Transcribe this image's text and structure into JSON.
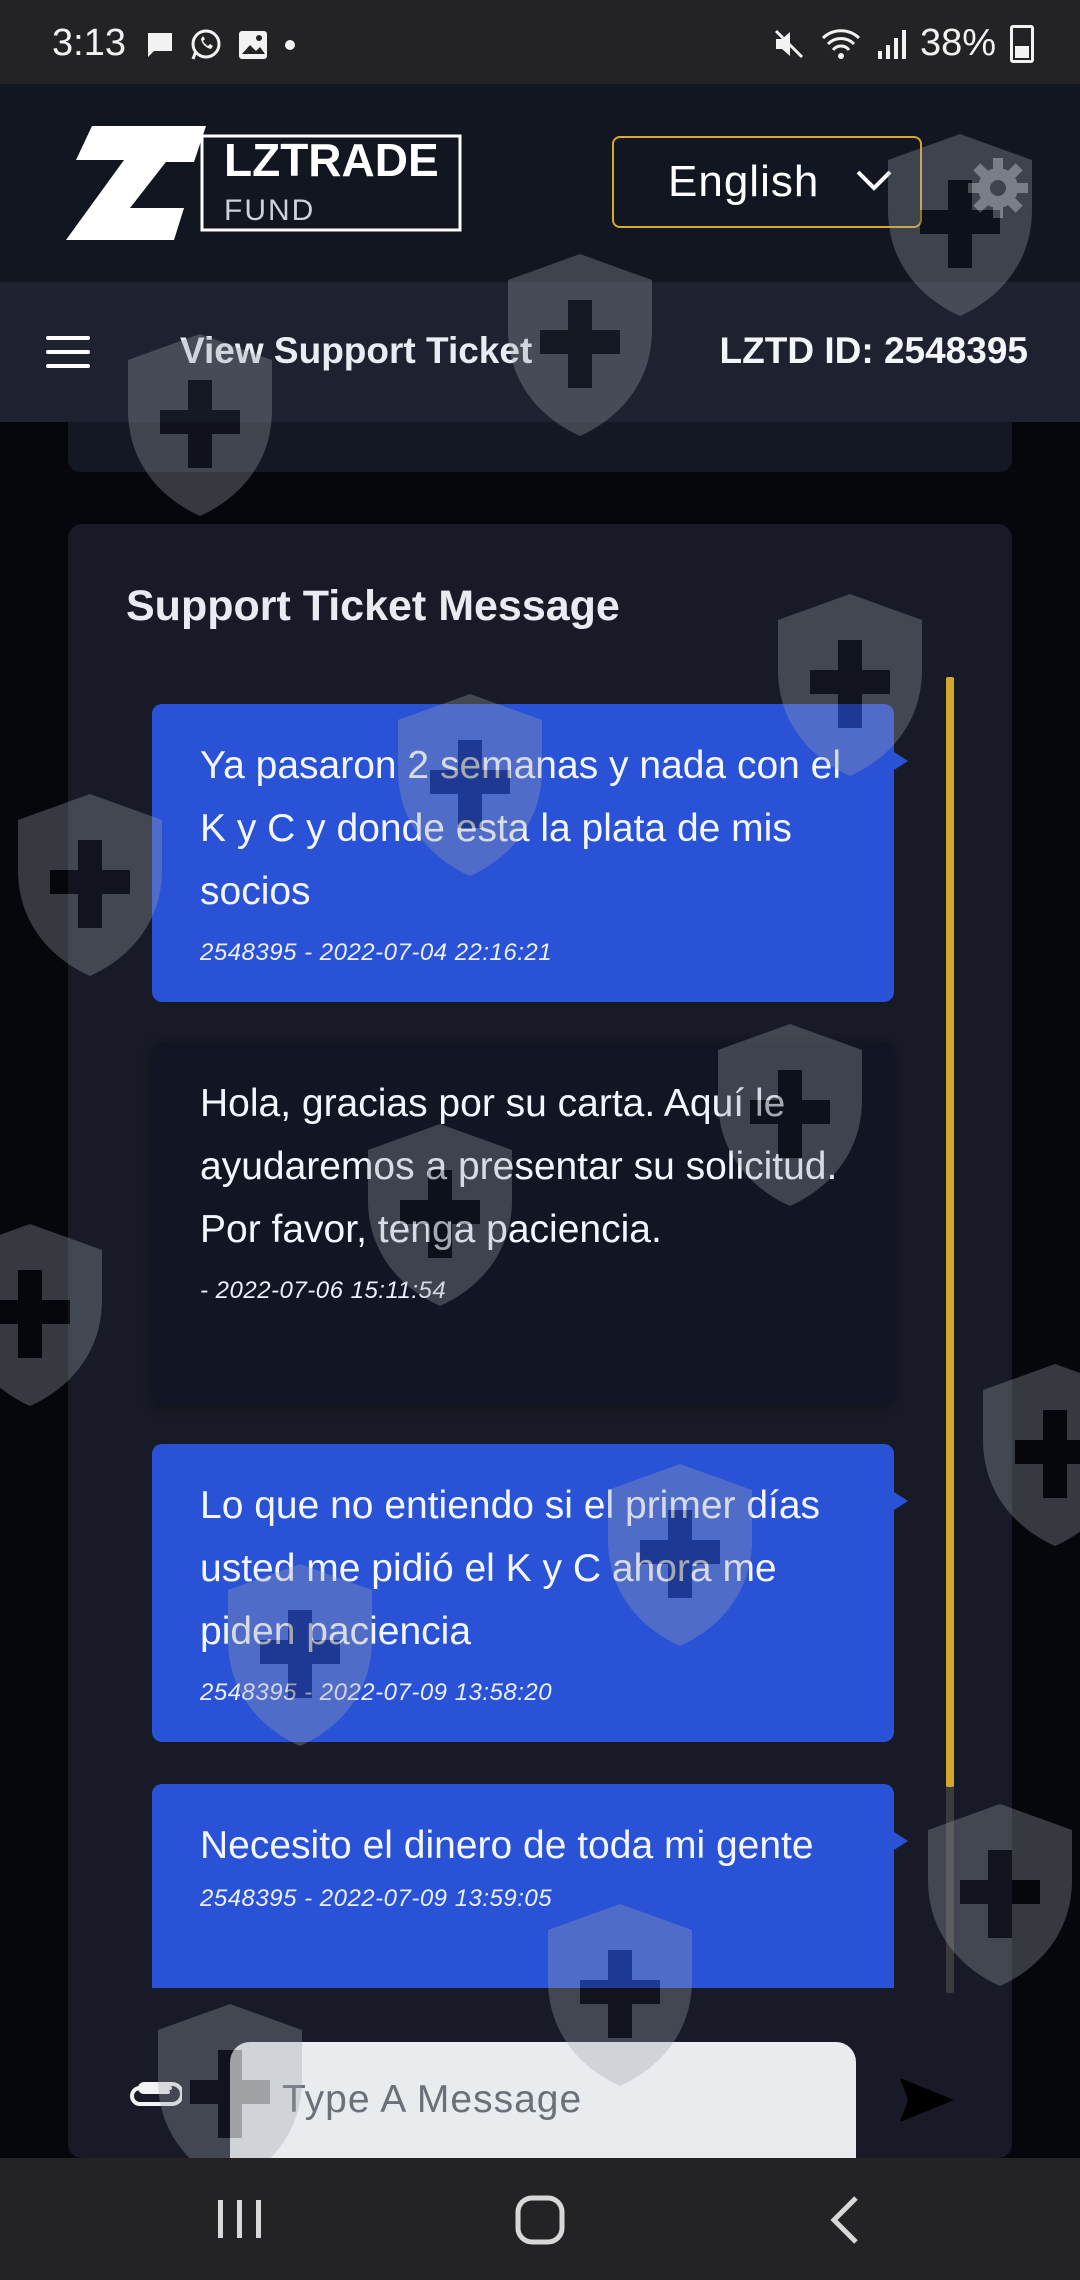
{
  "status_bar": {
    "time": "3:13",
    "battery": "38%",
    "icons": [
      "message-icon",
      "whatsapp-icon",
      "gallery-icon",
      "dot-icon",
      "mute-icon",
      "wifi-icon",
      "signal-icon",
      "battery-icon"
    ]
  },
  "brand": {
    "logo_main": "LZTRADE",
    "logo_sub": "FUND"
  },
  "language_select": {
    "value": "English"
  },
  "nav": {
    "title": "View Support Ticket",
    "id_label": "LZTD ID: 2548395"
  },
  "ticket": {
    "title": "Support Ticket Message",
    "messages": [
      {
        "role": "user",
        "text": "Ya pasaron 2 semanas y nada con el K y C y donde esta la plata de mis socios",
        "meta": "2548395 - 2022-07-04 22:16:21"
      },
      {
        "role": "agent",
        "text": "Hola, gracias por su carta. Aquí le ayudaremos a presentar su solicitud. Por favor, tenga paciencia.",
        "meta": "- 2022-07-06 15:11:54"
      },
      {
        "role": "user",
        "text": "Lo que no entiendo si el primer días usted me pidió el K y C ahora me piden paciencia",
        "meta": "2548395 - 2022-07-09 13:58:20"
      },
      {
        "role": "user",
        "text": "Necesito el dinero de toda mi gente",
        "meta": "2548395 - 2022-07-09 13:59:05"
      }
    ]
  },
  "composer": {
    "placeholder": "Type A Message"
  },
  "colors": {
    "accent_gold": "#d4a72c",
    "user_bubble": "#2952d6",
    "agent_bubble": "#121624",
    "card_bg": "#181b27"
  }
}
